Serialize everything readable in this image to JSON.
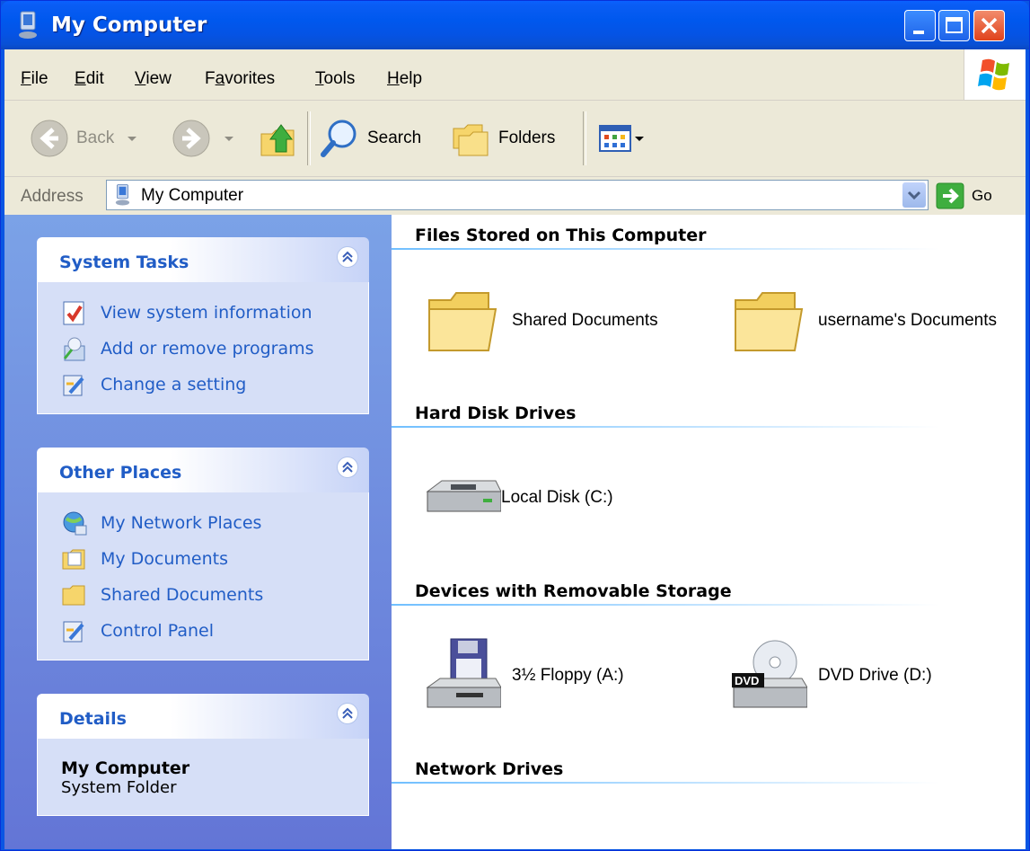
{
  "window": {
    "title": "My Computer",
    "title_icon": "computer-icon"
  },
  "menu": [
    {
      "label": "File",
      "key": "F",
      "rest": "ile"
    },
    {
      "label": "Edit",
      "key": "E",
      "rest": "dit"
    },
    {
      "label": "View",
      "key": "V",
      "rest": "iew"
    },
    {
      "label": "Favorites",
      "pre": "F",
      "key": "a",
      "rest": "vorites"
    },
    {
      "label": "Tools",
      "key": "T",
      "rest": "ools"
    },
    {
      "label": "Help",
      "key": "H",
      "rest": "elp"
    }
  ],
  "toolbar": {
    "back": "Back",
    "search": "Search",
    "folders": "Folders"
  },
  "address": {
    "label": "Address",
    "value": "My Computer",
    "go": "Go"
  },
  "sidebar": {
    "system_tasks": {
      "title": "System Tasks",
      "items": [
        {
          "label": "View system information",
          "icon": "system-info-icon"
        },
        {
          "label": "Add or remove programs",
          "icon": "add-remove-icon"
        },
        {
          "label": "Change a setting",
          "icon": "control-panel-icon"
        }
      ]
    },
    "other_places": {
      "title": "Other Places",
      "items": [
        {
          "label": "My Network Places",
          "icon": "network-icon"
        },
        {
          "label": "My Documents",
          "icon": "documents-icon"
        },
        {
          "label": "Shared Documents",
          "icon": "folder-icon"
        },
        {
          "label": "Control Panel",
          "icon": "control-panel-icon"
        }
      ]
    },
    "details": {
      "title": "Details",
      "name": "My Computer",
      "type": "System Folder"
    }
  },
  "content": {
    "groups": {
      "files": "Files Stored on This Computer",
      "hdd": "Hard Disk Drives",
      "removable": "Devices with Removable Storage",
      "network": "Network Drives"
    },
    "items": {
      "shared_docs": "Shared Documents",
      "user_docs": "username's Documents",
      "local_disk": "Local Disk (C:)",
      "floppy": "3½ Floppy (A:)",
      "dvd": "DVD Drive (D:)",
      "dvd_badge": "DVD"
    }
  },
  "colors": {
    "accent": "#215dc6",
    "titlebar": "#0058ee",
    "sidebar": "#7ba2e7"
  }
}
